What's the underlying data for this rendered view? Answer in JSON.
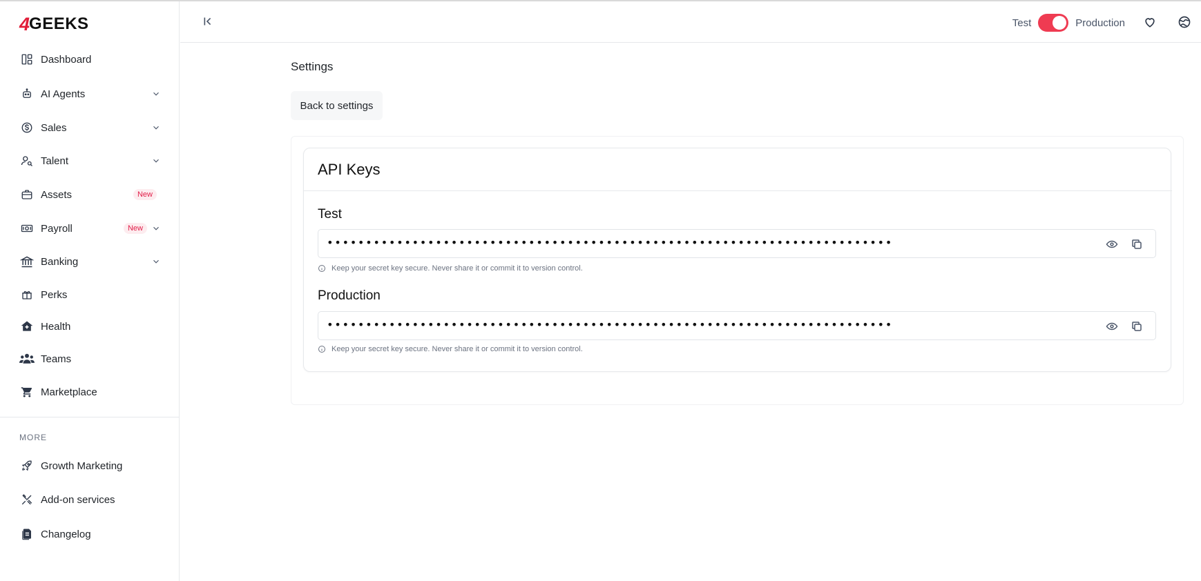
{
  "brand": {
    "mark": "4",
    "name": "GEEKS"
  },
  "sidebar": {
    "items": [
      {
        "label": "Dashboard",
        "icon": "dashboard-icon"
      },
      {
        "label": "AI Agents",
        "icon": "robot-icon",
        "expandable": true
      },
      {
        "label": "Sales",
        "icon": "dollar-icon",
        "expandable": true
      },
      {
        "label": "Talent",
        "icon": "user-search-icon",
        "expandable": true
      },
      {
        "label": "Assets",
        "icon": "briefcase-icon",
        "badge": "New"
      },
      {
        "label": "Payroll",
        "icon": "money-icon",
        "badge": "New",
        "expandable": true
      },
      {
        "label": "Banking",
        "icon": "bank-icon",
        "expandable": true
      },
      {
        "label": "Perks",
        "icon": "gift-icon"
      },
      {
        "label": "Health",
        "icon": "home-health-icon"
      },
      {
        "label": "Teams",
        "icon": "users-icon"
      },
      {
        "label": "Marketplace",
        "icon": "cart-icon"
      }
    ],
    "more_label": "MORE",
    "more_items": [
      {
        "label": "Growth Marketing",
        "icon": "rocket-icon"
      },
      {
        "label": "Add-on services",
        "icon": "tools-icon"
      },
      {
        "label": "Changelog",
        "icon": "document-icon"
      }
    ]
  },
  "topbar": {
    "env_left": "Test",
    "env_right": "Production",
    "toggle_on": true,
    "accent": "#ef3b52"
  },
  "main": {
    "title": "Settings",
    "back_label": "Back to settings",
    "card_title": "API Keys",
    "keys": [
      {
        "label": "Test",
        "masked": "•••••••••••••••••••••••••••••••••••••••••••••••••••••••••••••••••••••••••",
        "hint": "Keep your secret key secure. Never share it or commit it to version control."
      },
      {
        "label": "Production",
        "masked": "•••••••••••••••••••••••••••••••••••••••••••••••••••••••••••••••••••••••••",
        "hint": "Keep your secret key secure. Never share it or commit it to version control."
      }
    ]
  }
}
